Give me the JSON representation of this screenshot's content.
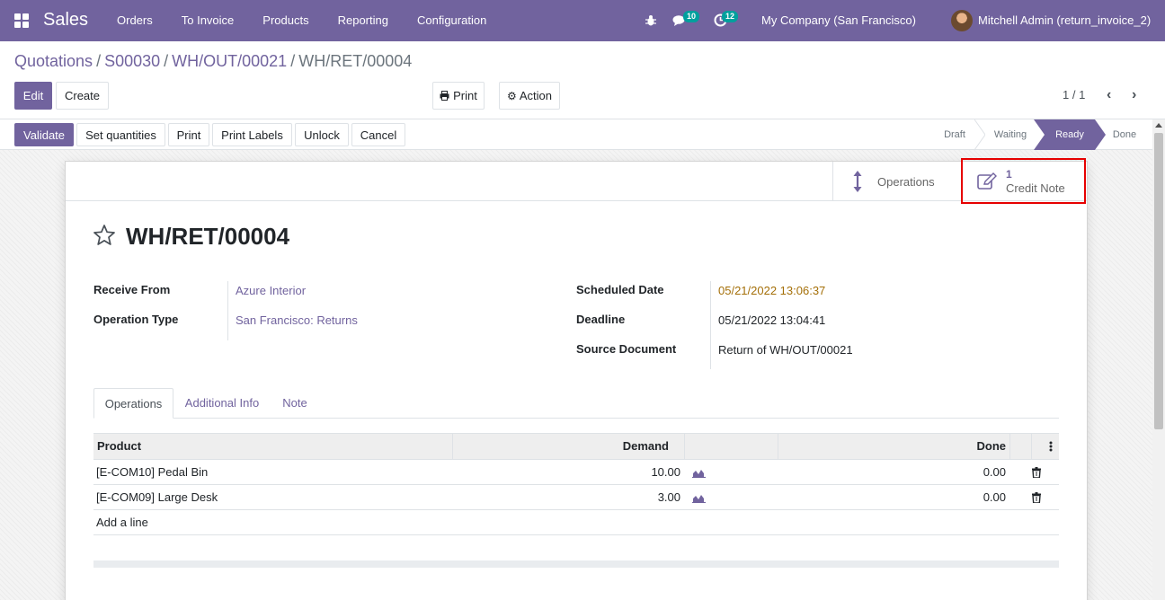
{
  "navbar": {
    "app_name": "Sales",
    "menu": [
      "Orders",
      "To Invoice",
      "Products",
      "Reporting",
      "Configuration"
    ],
    "messages_count": "10",
    "activities_count": "12",
    "company": "My Company (San Francisco)",
    "user": "Mitchell Admin (return_invoice_2)"
  },
  "breadcrumb": {
    "items": [
      "Quotations",
      "S00030",
      "WH/OUT/00021"
    ],
    "current": "WH/RET/00004"
  },
  "control": {
    "edit": "Edit",
    "create": "Create",
    "print": "Print",
    "action": "Action",
    "pager": "1 / 1"
  },
  "statusbar": {
    "buttons": [
      "Validate",
      "Set quantities",
      "Print",
      "Print Labels",
      "Unlock",
      "Cancel"
    ],
    "stages": [
      "Draft",
      "Waiting",
      "Ready",
      "Done"
    ],
    "active_stage": "Ready"
  },
  "smart_buttons": {
    "operations": "Operations",
    "credit_count": "1",
    "credit_label": "Credit Note"
  },
  "record": {
    "title": "WH/RET/00004",
    "receive_from_label": "Receive From",
    "receive_from": "Azure Interior",
    "operation_type_label": "Operation Type",
    "operation_type": "San Francisco: Returns",
    "scheduled_date_label": "Scheduled Date",
    "scheduled_date": "05/21/2022 13:06:37",
    "deadline_label": "Deadline",
    "deadline": "05/21/2022 13:04:41",
    "source_document_label": "Source Document",
    "source_document": "Return of WH/OUT/00021"
  },
  "tabs": [
    "Operations",
    "Additional Info",
    "Note"
  ],
  "table": {
    "headers": {
      "product": "Product",
      "demand": "Demand",
      "done": "Done"
    },
    "rows": [
      {
        "product": "[E-COM10] Pedal Bin",
        "demand": "10.00",
        "done": "0.00"
      },
      {
        "product": "[E-COM09] Large Desk",
        "demand": "3.00",
        "done": "0.00"
      }
    ],
    "add_line": "Add a line"
  },
  "colors": {
    "brand": "#71639e",
    "warning_date": "#a46f08",
    "highlight_border": "#e60000"
  }
}
